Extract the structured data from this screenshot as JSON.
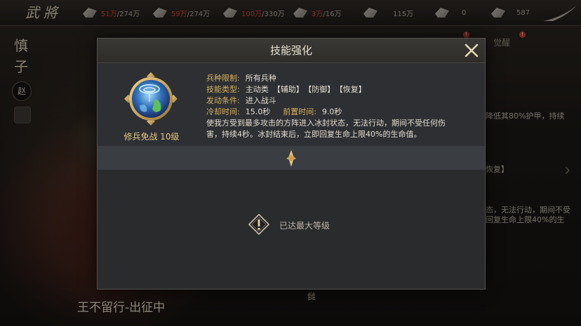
{
  "topbar": {
    "title": "武將",
    "resources": [
      {
        "icon": "grain-icon",
        "value": "51万",
        "cap": "/274万",
        "color": "#c8433a"
      },
      {
        "icon": "wood-icon",
        "value": "59万",
        "cap": "/274万",
        "color": "#c8433a"
      },
      {
        "icon": "stone-icon",
        "value": "100万",
        "cap": "/330万",
        "color": "#c8433a"
      },
      {
        "icon": "iron-icon",
        "value": "3万",
        "cap": "/16万",
        "color": "#c8433a"
      },
      {
        "icon": "copper-icon",
        "value": "115万",
        "cap": "",
        "color": "#a9a294"
      },
      {
        "icon": "gold-icon",
        "value": "0",
        "cap": "",
        "color": "#a9a294"
      },
      {
        "icon": "jade-icon",
        "value": "587",
        "cap": "",
        "color": "#a9a294"
      }
    ]
  },
  "side": {
    "general_name": "慎子",
    "faction_badge": "赵"
  },
  "background": {
    "army_status": "王不留行-出征中",
    "right_tab": "觉醒",
    "notify_1": "!",
    "notify_2": "!",
    "frag_1": "降低其80%护甲，持续",
    "frag_2": "恢复】",
    "frag_3": "态，无法行动，期间不受",
    "frag_4": "回复生命上限40%的生",
    "bottom_mini": "雠"
  },
  "dialog": {
    "title": "技能强化",
    "skill_name": "修兵免战 10级",
    "fields": {
      "troop_label": "兵种限制:",
      "troop_value": "所有兵种",
      "type_label": "技能类型:",
      "type_value": "主动类",
      "type_tags": [
        "【辅助】",
        "【防御】",
        "【恢复】"
      ],
      "trigger_label": "发动条件:",
      "trigger_value": "进入战斗",
      "cooldown_label": "冷却时间:",
      "cooldown_value": "15.0秒",
      "precast_label": "前置时间:",
      "precast_value": "9.0秒"
    },
    "description": "使我方受到最多攻击的方阵进入冰封状态，无法行动，期间不受任何伤害，持续4秒。冰封结束后，立即回复生命上限40%的生命值。",
    "max_level_text": "已达最大等级"
  },
  "colors": {
    "accent_gold": "#d8b25c",
    "dialog_bg": "#2b2c2e",
    "warning_red": "#c8433a"
  }
}
